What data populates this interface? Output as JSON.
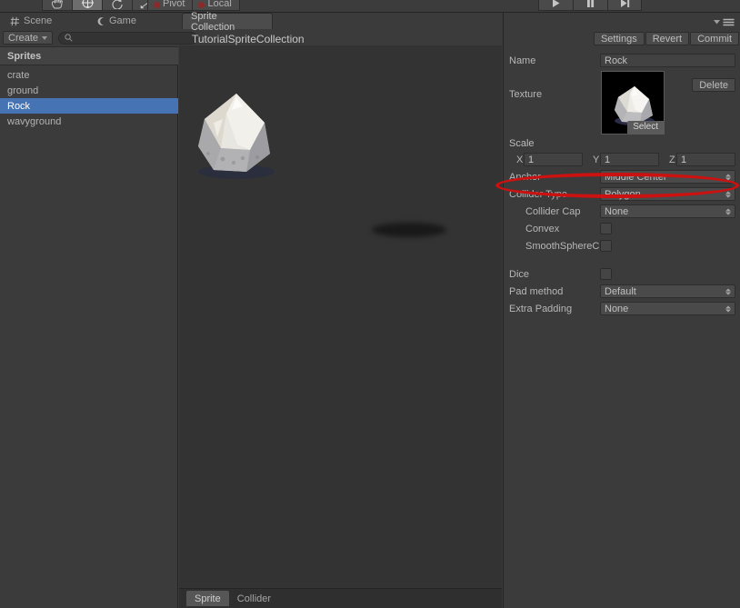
{
  "toolbar": {
    "tools": [
      {
        "name": "hand-tool",
        "active": false
      },
      {
        "name": "move-tool",
        "active": true
      },
      {
        "name": "rotate-tool",
        "active": false
      },
      {
        "name": "scale-tool",
        "active": false
      }
    ],
    "pivot_label": "Pivot",
    "local_label": "Local",
    "play_label": "play",
    "pause_label": "pause",
    "step_label": "step"
  },
  "tabs": [
    {
      "label": "Scene",
      "icon": "grid-icon",
      "active": false
    },
    {
      "label": "Game",
      "icon": "gamepad-icon",
      "active": false
    },
    {
      "label": "Sprite Collection",
      "icon": "",
      "active": true
    }
  ],
  "left_panel": {
    "create_label": "Create",
    "search_placeholder": "",
    "search_value": "",
    "header": "Sprites",
    "sprites": [
      {
        "label": "crate",
        "selected": false
      },
      {
        "label": "ground",
        "selected": false
      },
      {
        "label": "Rock",
        "selected": true
      },
      {
        "label": "wavyground",
        "selected": false
      }
    ]
  },
  "asset": {
    "title": "TutorialSpriteCollection",
    "header_buttons": [
      {
        "label": "Settings"
      },
      {
        "label": "Revert"
      },
      {
        "label": "Commit"
      }
    ]
  },
  "inspector": {
    "name_label": "Name",
    "name_value": "Rock",
    "texture_label": "Texture",
    "texture_select_label": "Select",
    "delete_label": "Delete",
    "scale_label": "Scale",
    "scale": {
      "x_label": "X",
      "x_value": "1",
      "y_label": "Y",
      "y_value": "1",
      "z_label": "Z",
      "z_value": "1"
    },
    "anchor_label": "Anchor",
    "anchor_value": "Middle Center",
    "collider_type_label": "Collider Type",
    "collider_type_value": "Polygon",
    "collider_cap_label": "Collider Cap",
    "collider_cap_value": "None",
    "convex_label": "Convex",
    "convex_checked": false,
    "smooth_sphere_label": "SmoothSphereC",
    "smooth_sphere_checked": false,
    "dice_label": "Dice",
    "dice_checked": false,
    "pad_method_label": "Pad method",
    "pad_method_value": "Default",
    "extra_padding_label": "Extra Padding",
    "extra_padding_value": "None"
  },
  "bottom_tabs": [
    {
      "label": "Sprite",
      "active": true
    },
    {
      "label": "Collider",
      "active": false
    }
  ],
  "annotation": {
    "target": "collider-type-row",
    "color": "#cc1111",
    "shape": "ellipse"
  },
  "colors": {
    "selection_blue": "#4573b4",
    "panel_bg": "#3b3b3b",
    "viewport_bg": "#333333",
    "annotation_red": "#cc1111"
  }
}
